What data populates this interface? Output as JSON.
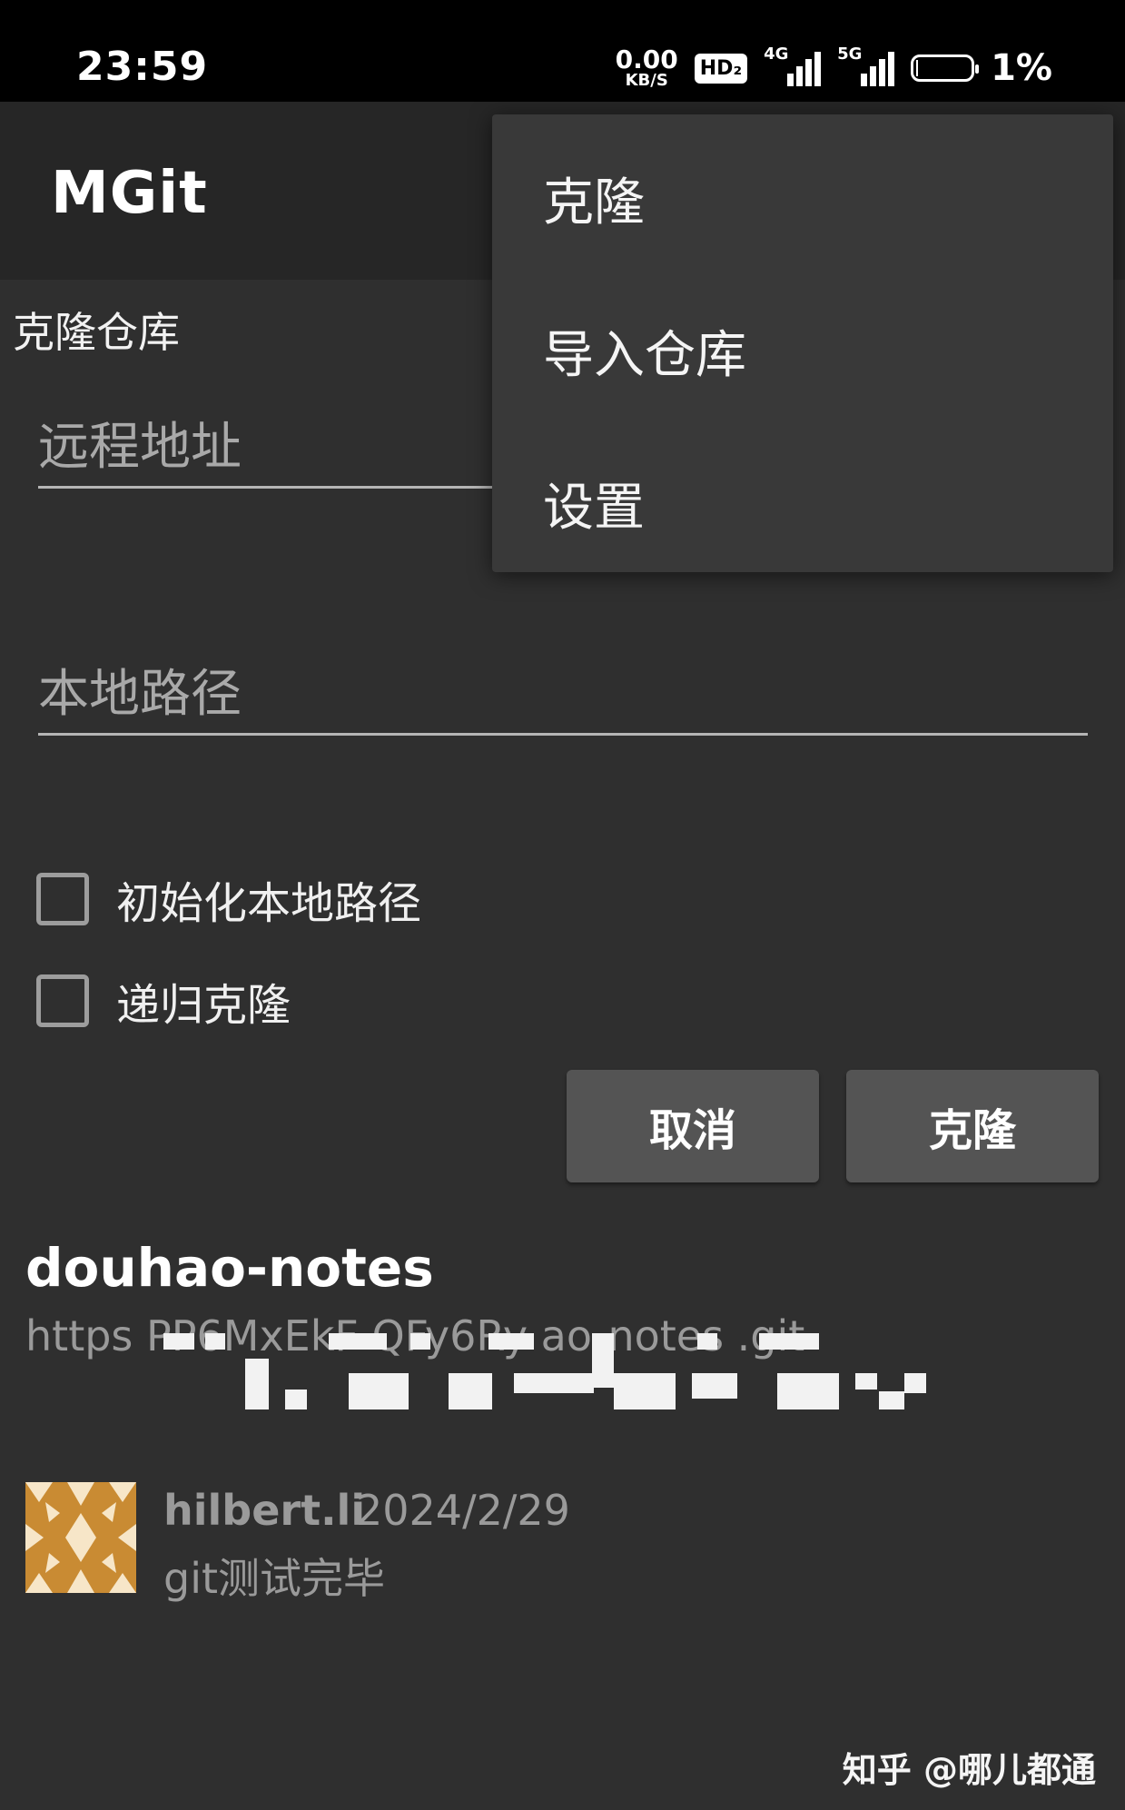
{
  "status_bar": {
    "time": "23:59",
    "net_speed_value": "0.00",
    "net_speed_unit": "KB/S",
    "hd_badge": "HD₂",
    "signal_1_label": "4G",
    "signal_2_label": "5G",
    "battery_percent": "1%"
  },
  "app_bar": {
    "title": "MGit"
  },
  "overflow_menu": {
    "items": [
      {
        "label": "克隆"
      },
      {
        "label": "导入仓库"
      },
      {
        "label": "设置"
      }
    ]
  },
  "clone_dialog": {
    "title": "克隆仓库",
    "remote_url_placeholder": "远程地址",
    "local_path_placeholder": "本地路径",
    "init_local_label": "初始化本地路径",
    "recursive_label": "递归克隆",
    "cancel_label": "取消",
    "clone_label": "克隆"
  },
  "repo": {
    "name": "douhao-notes",
    "url": "https                                                    PP6MxEkF QFy6Ry                                                 ao-notes .git",
    "commit": {
      "author": "hilbert.li",
      "date": "2024/2/29",
      "message": "git测试完毕"
    }
  },
  "watermark": "知乎 @哪儿都通",
  "colors": {
    "background": "#2f2f2f",
    "app_bar": "#262626",
    "menu": "#393939",
    "button": "#545454",
    "avatar": "#c98b33"
  }
}
